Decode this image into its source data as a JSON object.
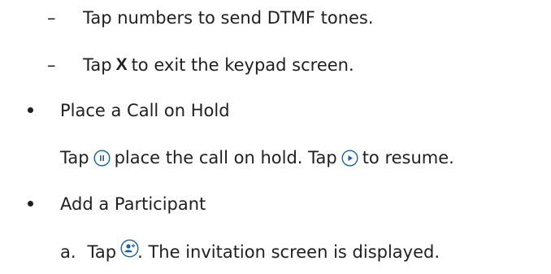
{
  "items": {
    "dtmf": {
      "marker": "–",
      "text": "Tap numbers to send DTMF tones."
    },
    "exit": {
      "marker": "–",
      "prefix": "Tap",
      "key": "X",
      "suffix": "to exit the keypad screen."
    },
    "hold": {
      "heading": "Place a Call on Hold",
      "part1": "Tap",
      "part2": "place the call on hold. Tap",
      "part3": "to resume.",
      "pause_icon": "pause-icon",
      "play_icon": "play-icon"
    },
    "participant": {
      "heading": "Add a Participant",
      "step_marker": "a.",
      "part1": "Tap",
      "part2": ". The invitation screen is displayed.",
      "add_icon": "add-participant-icon"
    }
  },
  "colors": {
    "text": "#1f1f1f",
    "icon_accent": "#1a5fa8"
  }
}
